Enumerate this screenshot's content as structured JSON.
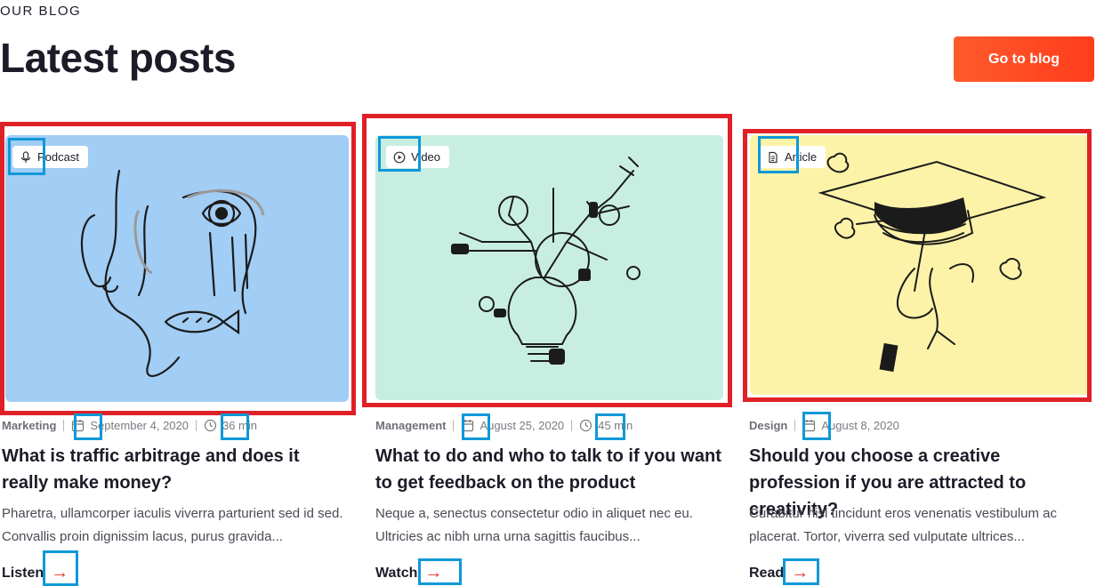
{
  "header": {
    "eyebrow": "OUR BLOG",
    "title": "Latest posts",
    "button_label": "Go to blog"
  },
  "colors": {
    "accent": "#ff4a24",
    "card1_bg": "#a2cdf4",
    "card2_bg": "#c8eee2",
    "card3_bg": "#fdf3a8",
    "highlight_red": "#e02027",
    "highlight_blue": "#1098d8"
  },
  "posts": [
    {
      "badge": "Podcast",
      "badge_icon": "microphone-icon",
      "category": "Marketing",
      "date": "September 4, 2020",
      "duration": "36 min",
      "title": "What is traffic arbitrage and does it really make money?",
      "excerpt": "Pharetra, ullamcorper iaculis viverra parturient sed id sed. Convallis proin dignissim lacus, purus gravida...",
      "cta": "Listen"
    },
    {
      "badge": "Video",
      "badge_icon": "play-icon",
      "category": "Management",
      "date": "August 25, 2020",
      "duration": "45 min",
      "title": "What to do and who to talk to if you want to get feedback on the product",
      "excerpt": "Neque a, senectus consectetur odio in aliquet nec eu. Ultricies ac nibh urna urna sagittis faucibus...",
      "cta": "Watch"
    },
    {
      "badge": "Article",
      "badge_icon": "document-icon",
      "category": "Design",
      "date": "August 8, 2020",
      "title": "Should you choose a creative profession if you are attracted to creativity?",
      "excerpt": "Curabitur nisl tincidunt eros venenatis vestibulum ac placerat. Tortor, viverra sed vulputate ultrices...",
      "cta": "Read"
    }
  ]
}
